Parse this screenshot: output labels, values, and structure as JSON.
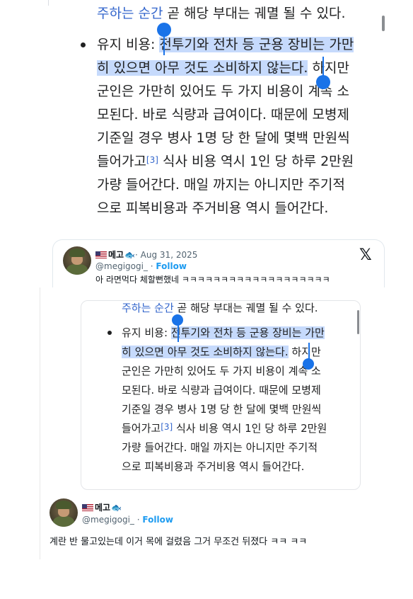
{
  "wiki": {
    "line1_link": "주하는 순간",
    "line1_rest": " 곧 해당 부대는 궤멸 될 수 있다.",
    "bullet_label": "유지 비용: ",
    "row1_sel": "전투기와 전차 등 군용 장비는 가만",
    "row2_sel": "히 있으면 아무 것도 소비하지 않는다.",
    "row2_rest": " 하지만",
    "row3": "군인은 가만히 있어도 두 가지 비용이 계속 소",
    "row4": "모된다. 바로 식량과 급여이다. 때문에 모병제",
    "row5": "기준일 경우 병사 1명 당 한 달에 몇백 만원씩",
    "row6_pre": "들어가고",
    "row6_ref": "[3]",
    "row6_post": " 식사 비용 역시 1인 당 하루 2만원",
    "row7": "가량 들어간다. 매일 까지는 아니지만 주기적",
    "row8": "으로 피복비용과 주거비용 역시 들어간다."
  },
  "tweet_top": {
    "display_name": "메고",
    "date": "· Aug 31, 2025",
    "handle": "@megigogi_",
    "separator": " · ",
    "follow_label": "Follow",
    "text": "아 라면먹다 체할뻔했네 ㅋㅋㅋㅋㅋㅋㅋㅋㅋㅋㅋㅋㅋㅋㅋㅋㅋㅋㅋ",
    "x_logo": "𝕏"
  },
  "tweet_reply": {
    "display_name": "메고",
    "handle": "@megigogi_",
    "separator": " · ",
    "follow_label": "Follow",
    "text": "계란 반 물고있는데 이거 목에 걸렸음 그거 무조건 뒤졌다 ㅋㅋ ㅋㅋ"
  },
  "icons": {
    "flag": "us-flag-icon",
    "fish": "fish-icon",
    "x": "x-logo-icon"
  },
  "colors": {
    "link": "#3366cc",
    "selection": "#c6dafc",
    "handle": "#1a73e8",
    "follow": "#1d9bf0"
  }
}
